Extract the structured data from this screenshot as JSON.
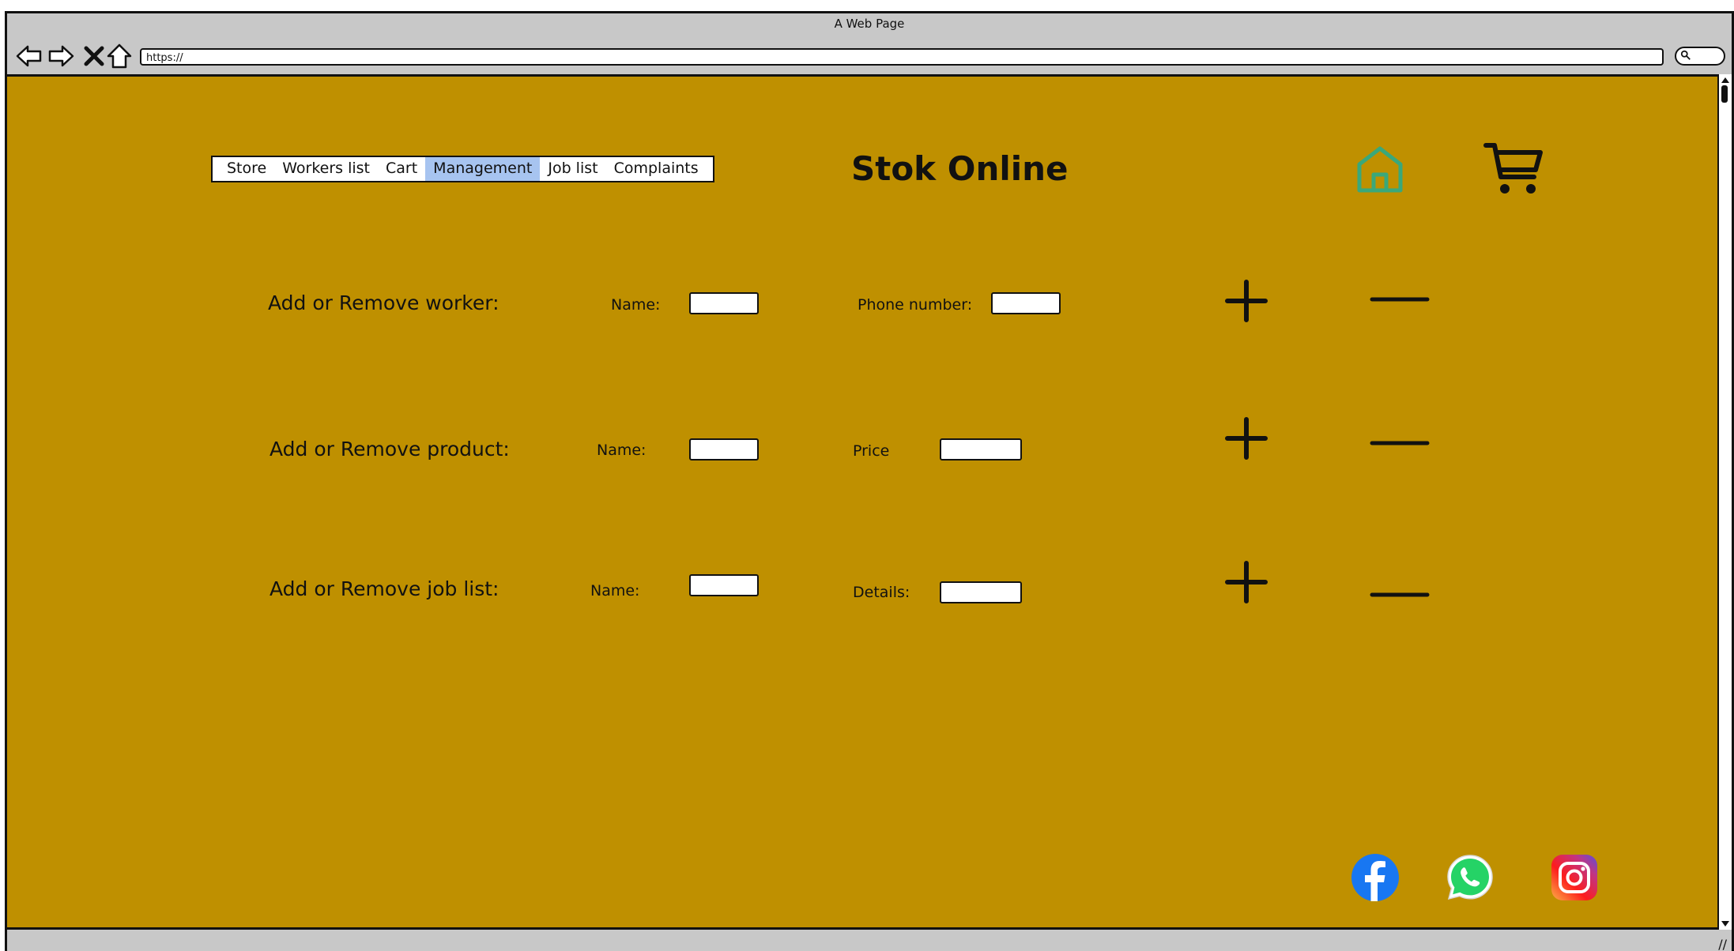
{
  "browser": {
    "window_title": "A Web Page",
    "url": "https://"
  },
  "nav": {
    "items": [
      {
        "label": "Store",
        "active": false
      },
      {
        "label": "Workers list",
        "active": false
      },
      {
        "label": "Cart",
        "active": false
      },
      {
        "label": "Management",
        "active": true
      },
      {
        "label": "Job list",
        "active": false
      },
      {
        "label": "Complaints",
        "active": false
      }
    ],
    "active_color": "#a7c4f0"
  },
  "header": {
    "title": "Stok Online",
    "icons": [
      "home-icon",
      "cart-icon"
    ]
  },
  "management": {
    "worker": {
      "label": "Add or Remove worker:",
      "field1_label": "Name:",
      "field1_value": "",
      "field2_label": "Phone number:",
      "field2_value": ""
    },
    "product": {
      "label": "Add or Remove product:",
      "field1_label": "Name:",
      "field1_value": "",
      "field2_label": "Price",
      "field2_value": ""
    },
    "joblist": {
      "label": "Add or Remove job list:",
      "field1_label": "Name:",
      "field1_value": "",
      "field2_label": "Details:",
      "field2_value": ""
    }
  },
  "footer": {
    "social": [
      "facebook-icon",
      "whatsapp-icon",
      "instagram-icon"
    ]
  },
  "colors": {
    "page_background": "#bf9000",
    "home_icon": "#3aa87a",
    "facebook": "#1877f2",
    "whatsapp": "#25d366"
  }
}
